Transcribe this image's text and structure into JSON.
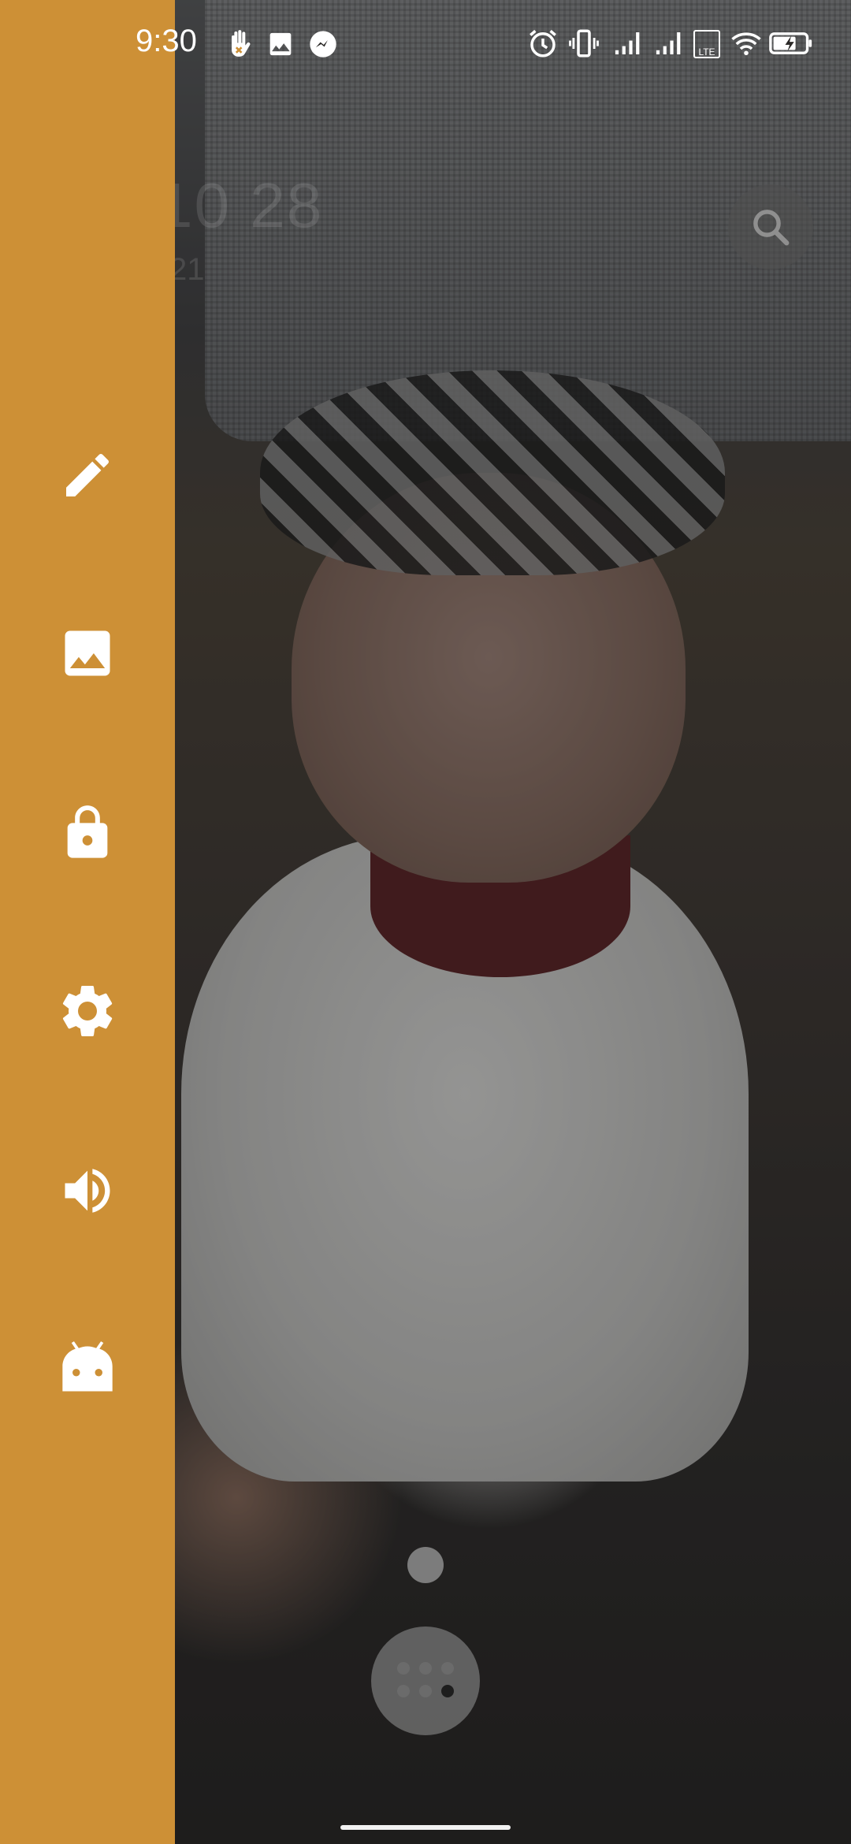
{
  "status_bar": {
    "time": "9:30",
    "left_icons": [
      "touch-gesture-icon",
      "image-icon",
      "messenger-icon"
    ],
    "right_icons": [
      "alarm-icon",
      "vibrate-icon",
      "signal-icon",
      "signal-icon",
      "volte-icon",
      "wifi-icon",
      "battery-charging-icon"
    ],
    "volte_label": "LTE"
  },
  "background": {
    "clock_text": "10 28",
    "date_text": "21"
  },
  "drawer": {
    "background_color": "#cd9036",
    "items": [
      {
        "icon": "pencil-icon"
      },
      {
        "icon": "image-icon"
      },
      {
        "icon": "lock-icon"
      },
      {
        "icon": "gear-icon"
      },
      {
        "icon": "volume-icon"
      },
      {
        "icon": "android-icon"
      }
    ]
  },
  "search": {
    "icon": "search-icon"
  },
  "dock": {
    "apps_icon": "apps-grid-icon"
  }
}
